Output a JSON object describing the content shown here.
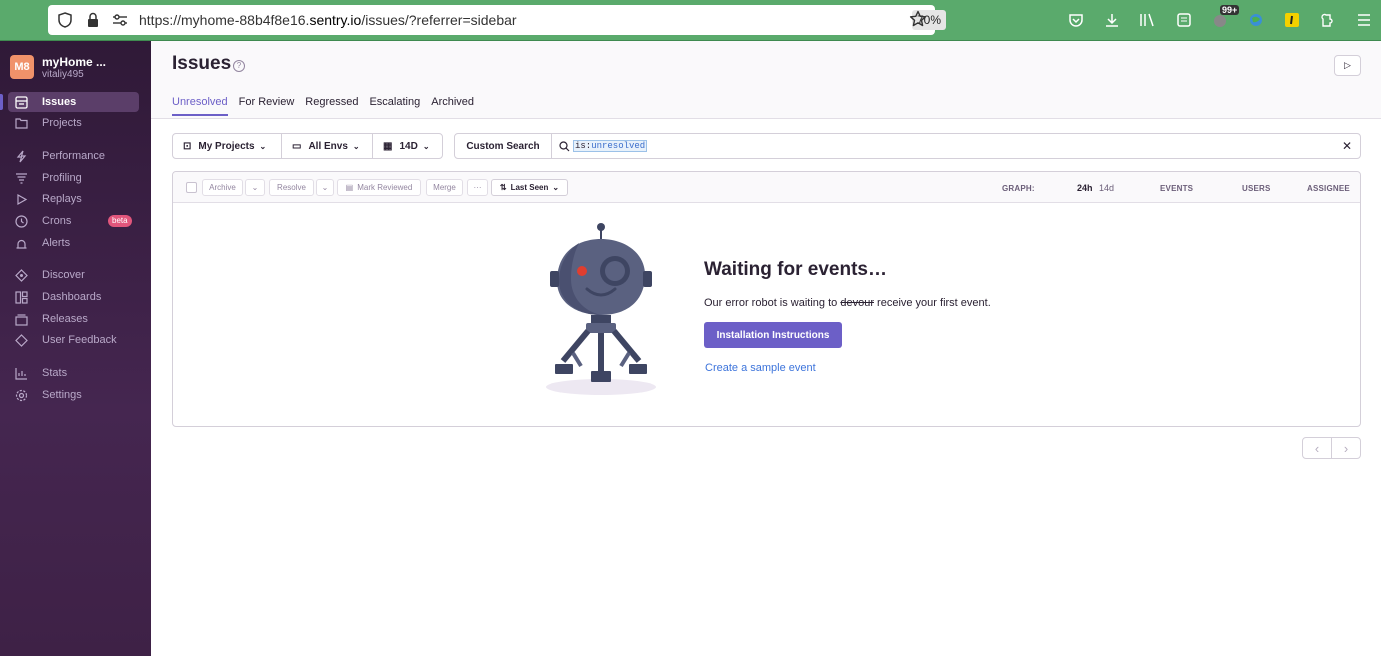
{
  "browser": {
    "url_prefix": "https://myhome-88b4f8e16.",
    "url_domain": "sentry.io",
    "url_path": "/issues/?referrer=sidebar",
    "zoom": "70%",
    "badge_count": "99+"
  },
  "sidebar": {
    "org_initials": "M8",
    "org_name": "myHome ...",
    "org_user": "vitaliy495",
    "items": [
      {
        "label": "Issues",
        "icon": "issues-icon"
      },
      {
        "label": "Projects",
        "icon": "projects-icon"
      },
      {
        "label": "Performance",
        "icon": "performance-icon"
      },
      {
        "label": "Profiling",
        "icon": "profiling-icon"
      },
      {
        "label": "Replays",
        "icon": "replays-icon"
      },
      {
        "label": "Crons",
        "icon": "crons-icon",
        "badge": "beta"
      },
      {
        "label": "Alerts",
        "icon": "alerts-icon"
      },
      {
        "label": "Discover",
        "icon": "discover-icon"
      },
      {
        "label": "Dashboards",
        "icon": "dashboards-icon"
      },
      {
        "label": "Releases",
        "icon": "releases-icon"
      },
      {
        "label": "User Feedback",
        "icon": "feedback-icon"
      },
      {
        "label": "Stats",
        "icon": "stats-icon"
      },
      {
        "label": "Settings",
        "icon": "settings-icon"
      }
    ]
  },
  "header": {
    "title": "Issues",
    "tabs": [
      "Unresolved",
      "For Review",
      "Regressed",
      "Escalating",
      "Archived"
    ]
  },
  "filters": {
    "projects": "My Projects",
    "envs": "All Envs",
    "period": "14D",
    "custom_search": "Custom Search",
    "query_key": "is:",
    "query_value": "unresolved"
  },
  "toolbar": {
    "archive": "Archive",
    "resolve": "Resolve",
    "mark_reviewed": "Mark Reviewed",
    "merge": "Merge",
    "more": "···",
    "sort": "Last Seen",
    "graph_label": "GRAPH:",
    "graph_24h": "24h",
    "graph_14d": "14d",
    "events": "EVENTS",
    "users": "USERS",
    "assignee": "ASSIGNEE"
  },
  "empty_state": {
    "title": "Waiting for events…",
    "msg_before": "Our error robot is waiting to ",
    "msg_strike": "devour",
    "msg_after": " receive your first event.",
    "install_button": "Installation Instructions",
    "sample_link": "Create a sample event"
  },
  "colors": {
    "accent": "#6c5fc7",
    "sidebar": "#2f1937",
    "browser": "#5aaa6c"
  }
}
